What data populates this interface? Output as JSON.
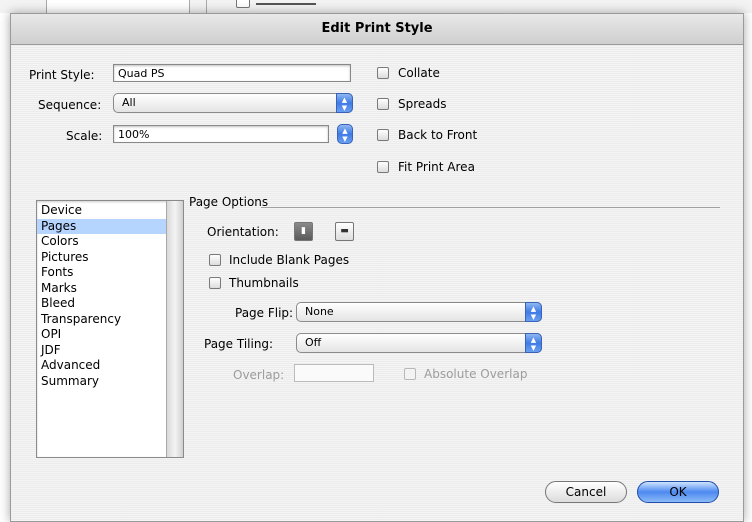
{
  "dialog": {
    "title": "Edit Print Style"
  },
  "top": {
    "print_style_label": "Print Style:",
    "print_style_value": "Quad PS",
    "sequence_label": "Sequence:",
    "sequence_value": "All",
    "scale_label": "Scale:",
    "scale_value": "100%"
  },
  "checks": {
    "collate": "Collate",
    "spreads": "Spreads",
    "back_to_front": "Back to Front",
    "fit_print_area": "Fit Print Area"
  },
  "categories": [
    "Device",
    "Pages",
    "Colors",
    "Pictures",
    "Fonts",
    "Marks",
    "Bleed",
    "Transparency",
    "OPI",
    "JDF",
    "Advanced",
    "Summary"
  ],
  "selected_category": "Pages",
  "page_options": {
    "title": "Page Options",
    "orientation_label": "Orientation:",
    "include_blank_pages": "Include Blank Pages",
    "thumbnails": "Thumbnails",
    "page_flip_label": "Page Flip:",
    "page_flip_value": "None",
    "page_tiling_label": "Page Tiling:",
    "page_tiling_value": "Off",
    "overlap_label": "Overlap:",
    "overlap_value": "",
    "absolute_overlap": "Absolute Overlap"
  },
  "buttons": {
    "cancel": "Cancel",
    "ok": "OK"
  },
  "icons": {
    "popup": "up-down-arrows-icon",
    "stepper": "stepper-arrows-icon",
    "portrait": "portrait-orientation-icon",
    "landscape": "landscape-orientation-icon"
  },
  "colors": {
    "accent": "#3f7be6",
    "selection": "#b5d5ff",
    "sheet": "#ececec"
  }
}
